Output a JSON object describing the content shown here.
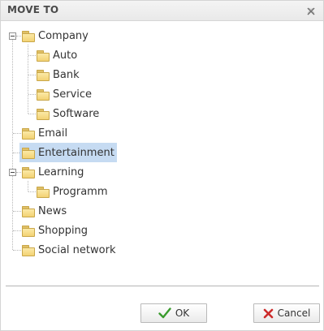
{
  "dialog": {
    "title": "MOVE TO",
    "close_icon": "close-x-icon"
  },
  "tree": {
    "nodes": [
      {
        "label": "Company",
        "expanded": true,
        "selected": false
      },
      {
        "label": "Auto",
        "selected": false
      },
      {
        "label": "Bank",
        "selected": false
      },
      {
        "label": "Service",
        "selected": false
      },
      {
        "label": "Software",
        "selected": false
      },
      {
        "label": "Email",
        "selected": false
      },
      {
        "label": "Entertainment",
        "selected": true
      },
      {
        "label": "Learning",
        "expanded": true,
        "selected": false
      },
      {
        "label": "Programm",
        "selected": false
      },
      {
        "label": "News",
        "selected": false
      },
      {
        "label": "Shopping",
        "selected": false
      },
      {
        "label": "Social network",
        "selected": false
      }
    ]
  },
  "buttons": {
    "ok_label": "OK",
    "cancel_label": "Cancel"
  },
  "colors": {
    "selected_bg": "#c6dbf2",
    "ok_icon": "#3a9b2e",
    "cancel_icon": "#cc2b2b"
  }
}
